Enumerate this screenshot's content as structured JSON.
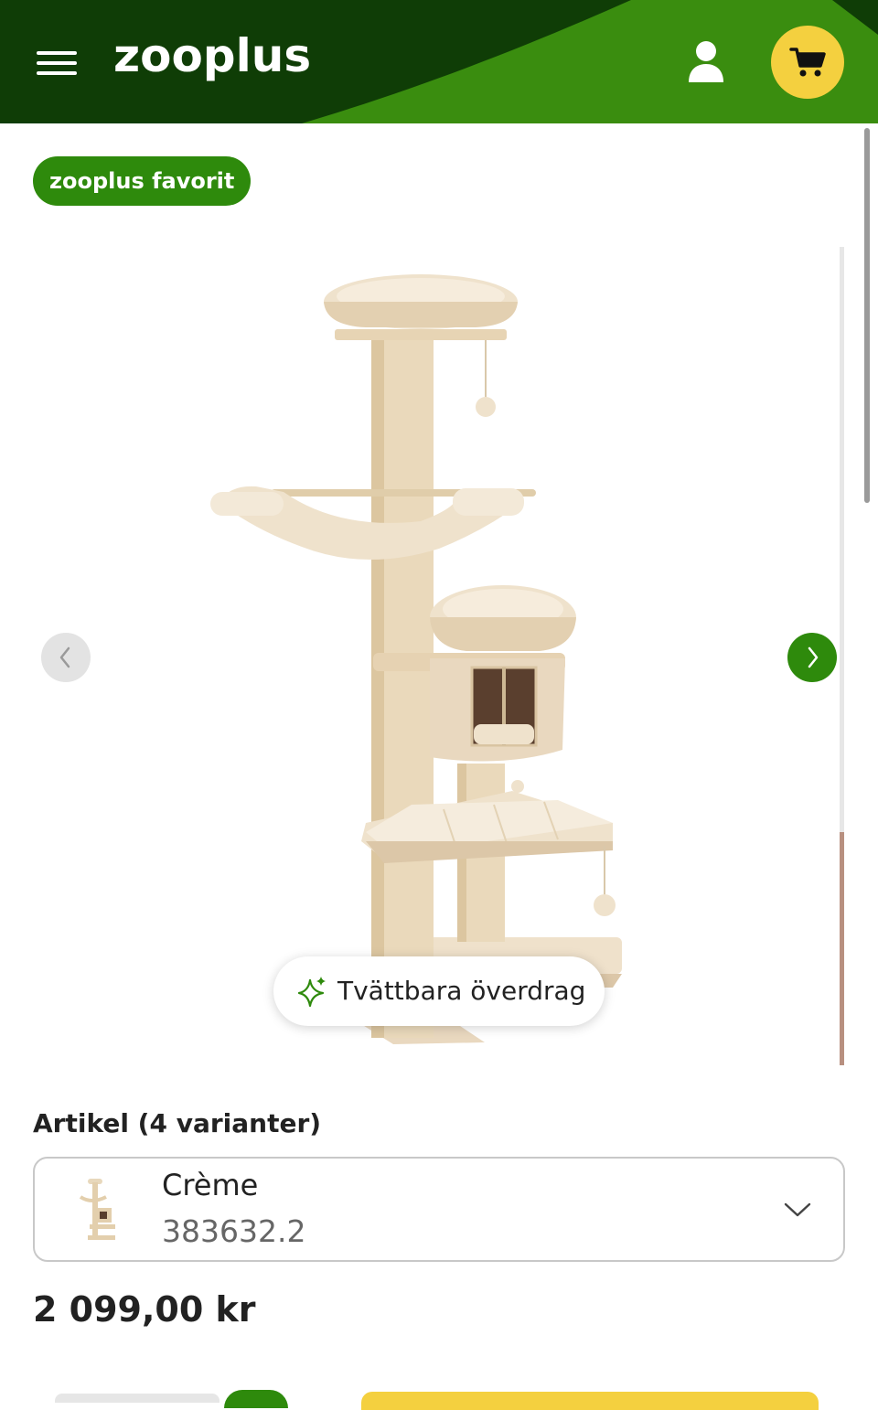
{
  "header": {
    "logo_text": "zooplus",
    "menu_icon": "hamburger-menu-icon",
    "account_icon": "user-icon",
    "cart_icon": "shopping-cart-icon",
    "colors": {
      "dark_green": "#0f3d06",
      "bright_green": "#3a8d0f",
      "cart_yellow": "#f4d03f"
    }
  },
  "badge": {
    "label": "zooplus favorit",
    "color": "#2e8a0c"
  },
  "gallery": {
    "prev_icon": "chevron-left-icon",
    "next_icon": "chevron-right-icon",
    "feature_chip": {
      "icon": "sparkle-icon",
      "label": "Tvättbara överdrag"
    }
  },
  "variant": {
    "heading": "Artikel (4 varianter)",
    "selected_name": "Crème",
    "selected_sku": "383632.2",
    "dropdown_icon": "chevron-down-icon"
  },
  "price": {
    "value": "2 099,00 kr"
  }
}
